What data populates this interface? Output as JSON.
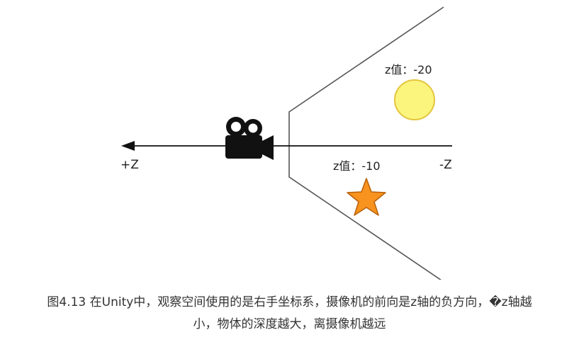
{
  "axis": {
    "left_label": "+Z",
    "right_label": "-Z"
  },
  "annotations": {
    "sphere_label": "z值：-20",
    "star_label": "z值：-10"
  },
  "icons": {
    "camera": "camera-icon",
    "sphere": "sphere-icon",
    "star": "star-icon"
  },
  "colors": {
    "sphere_fill": "#FBF57E",
    "sphere_stroke": "#E4C53D",
    "star_fill": "#F7931E",
    "star_stroke": "#B8600A",
    "line": "#555555",
    "axis": "#111111",
    "camera": "#111111"
  },
  "caption": {
    "line1": "图4.13 在Unity中，观察空间使用的是右手坐标系，摄像机的前向是z轴的负方向，�z轴越",
    "line2": "小，物体的深度越大，离摄像机越远"
  }
}
